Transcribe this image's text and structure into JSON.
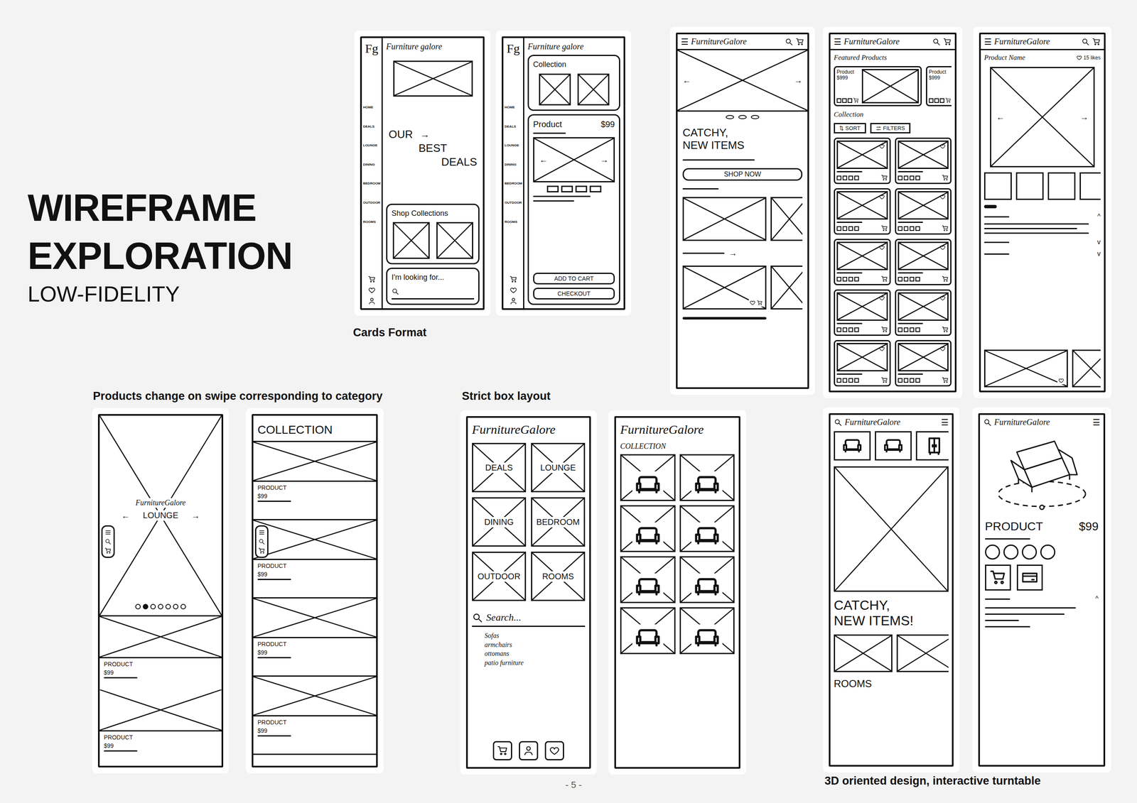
{
  "page": {
    "title": [
      "WIREFRAME",
      "EXPLORATION"
    ],
    "subtitle": "LOW-FIDELITY",
    "page_number": "- 5 -"
  },
  "captions": {
    "cards": "Cards Format",
    "swipe": "Products change on swipe corresponding to category",
    "box": "Strict box layout",
    "turntable": "3D oriented design, interactive turntable"
  },
  "cards_home": {
    "logo": "Fg",
    "brand": "Furniture galore",
    "nav": [
      "HOME",
      "DEALS",
      "LOUNGE",
      "DINING",
      "BEDROOM",
      "OUTDOOR",
      "ROOMS"
    ],
    "hero": [
      "OUR",
      "BEST",
      "DEALS"
    ],
    "hero_arrow": "→",
    "section": "Shop Collections",
    "search_label": "I'm looking for..."
  },
  "cards_product": {
    "logo": "Fg",
    "brand": "Furniture galore",
    "nav": [
      "HOME",
      "DEALS",
      "LOUNGE",
      "DINING",
      "BEDROOM",
      "OUTDOOR",
      "ROOMS"
    ],
    "section": "Collection",
    "product": "Product",
    "price": "$99",
    "arrows": [
      "←",
      "→"
    ],
    "buttons": [
      "ADD TO CART",
      "CHECKOUT"
    ]
  },
  "hero_home": {
    "menu": "☰",
    "brand": "FurnitureGalore",
    "arrows": [
      "←",
      "→"
    ],
    "headline": [
      "CATCHY,",
      "NEW ITEMS"
    ],
    "cta": "SHOP NOW",
    "more_arrow": "→"
  },
  "listing": {
    "menu": "☰",
    "brand": "FurnitureGalore",
    "section": "Featured Products",
    "featured": [
      {
        "name": "Product",
        "price": "$999"
      },
      {
        "name": "Product",
        "price": "$999"
      }
    ],
    "collection": "Collection",
    "sort": "⇅ SORT",
    "filters": "FILTERS"
  },
  "product_page": {
    "menu": "☰",
    "brand": "FurnitureGalore",
    "title": "Product Name",
    "likes": "15 likes",
    "arrows": [
      "←",
      "→"
    ],
    "accordion": [
      {
        "expanded": true,
        "chevron": "^"
      },
      {
        "expanded": false,
        "chevron": "v"
      },
      {
        "expanded": false,
        "chevron": "v"
      }
    ]
  },
  "swipe_home": {
    "brand": "FurnitureGalore",
    "category": "LOUNGE",
    "arrows": [
      "←",
      "→"
    ],
    "dots": [
      {
        "selected": false
      },
      {
        "selected": true
      },
      {
        "selected": false
      },
      {
        "selected": false
      },
      {
        "selected": false
      },
      {
        "selected": false
      },
      {
        "selected": false
      }
    ],
    "products": [
      {
        "name": "PRODUCT",
        "price": "$99"
      },
      {
        "name": "PRODUCT",
        "price": "$99"
      }
    ]
  },
  "swipe_collection": {
    "title": "COLLECTION",
    "products": [
      {
        "name": "PRODUCT",
        "price": "$99"
      },
      {
        "name": "PRODUCT",
        "price": "$99"
      },
      {
        "name": "PRODUCT",
        "price": "$99"
      },
      {
        "name": "PRODUCT",
        "price": "$99"
      }
    ]
  },
  "box_home": {
    "brand": "FurnitureGalore",
    "tiles": [
      "DEALS",
      "LOUNGE",
      "DINING",
      "BEDROOM",
      "OUTDOOR",
      "ROOMS"
    ],
    "search": "Search...",
    "suggestions": [
      "Sofas",
      "armchairs",
      "ottomans",
      "patio furniture"
    ]
  },
  "box_collection": {
    "brand": "FurnitureGalore",
    "title": "COLLECTION"
  },
  "turntable_home": {
    "brand": "FurnitureGalore",
    "menu": "☰",
    "headline": [
      "CATCHY,",
      "NEW ITEMS!"
    ],
    "section": "ROOMS"
  },
  "turntable_product": {
    "brand": "FurnitureGalore",
    "menu": "☰",
    "product": "PRODUCT",
    "price": "$99",
    "chevron": "^"
  }
}
